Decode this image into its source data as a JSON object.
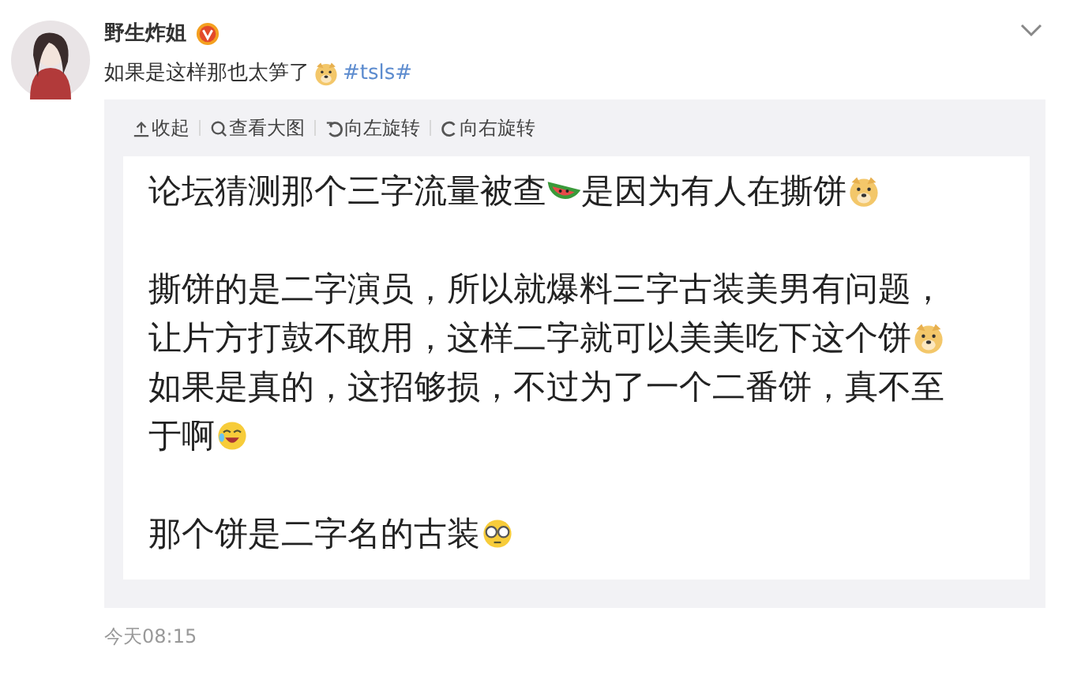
{
  "post": {
    "author": "野生炸姐",
    "verified": true,
    "text": "如果是这样那也太笋了",
    "hashtag": "#tsls#",
    "time": "今天08:15"
  },
  "toolbar": [
    {
      "label": "收起"
    },
    {
      "label": "查看大图"
    },
    {
      "label": "向左旋转"
    },
    {
      "label": "向右旋转"
    }
  ],
  "image_text": [
    [
      [
        {
          "kind": "text",
          "text": "论坛猜测那个三字流量被查"
        },
        {
          "kind": "emoji"
        },
        {
          "kind": "text",
          "text": "是因为有人在撕饼"
        },
        {
          "kind": "emoji"
        }
      ]
    ],
    [
      [
        {
          "kind": "text",
          "text": "撕饼的是二字演员，所以就爆料三字古装美男有问题，"
        }
      ],
      [
        {
          "kind": "text",
          "text": "让片方打鼓不敢用，这样二字就可以美美吃下这个饼"
        },
        {
          "kind": "emoji"
        }
      ],
      [
        {
          "kind": "text",
          "text": "如果是真的，这招够损，不过为了一个二番饼，真不至"
        }
      ],
      [
        {
          "kind": "text",
          "text": "于啊"
        },
        {
          "kind": "emoji"
        }
      ]
    ],
    [
      [
        {
          "kind": "text",
          "text": "那个饼是二字名的古装"
        },
        {
          "kind": "emoji"
        }
      ]
    ]
  ]
}
